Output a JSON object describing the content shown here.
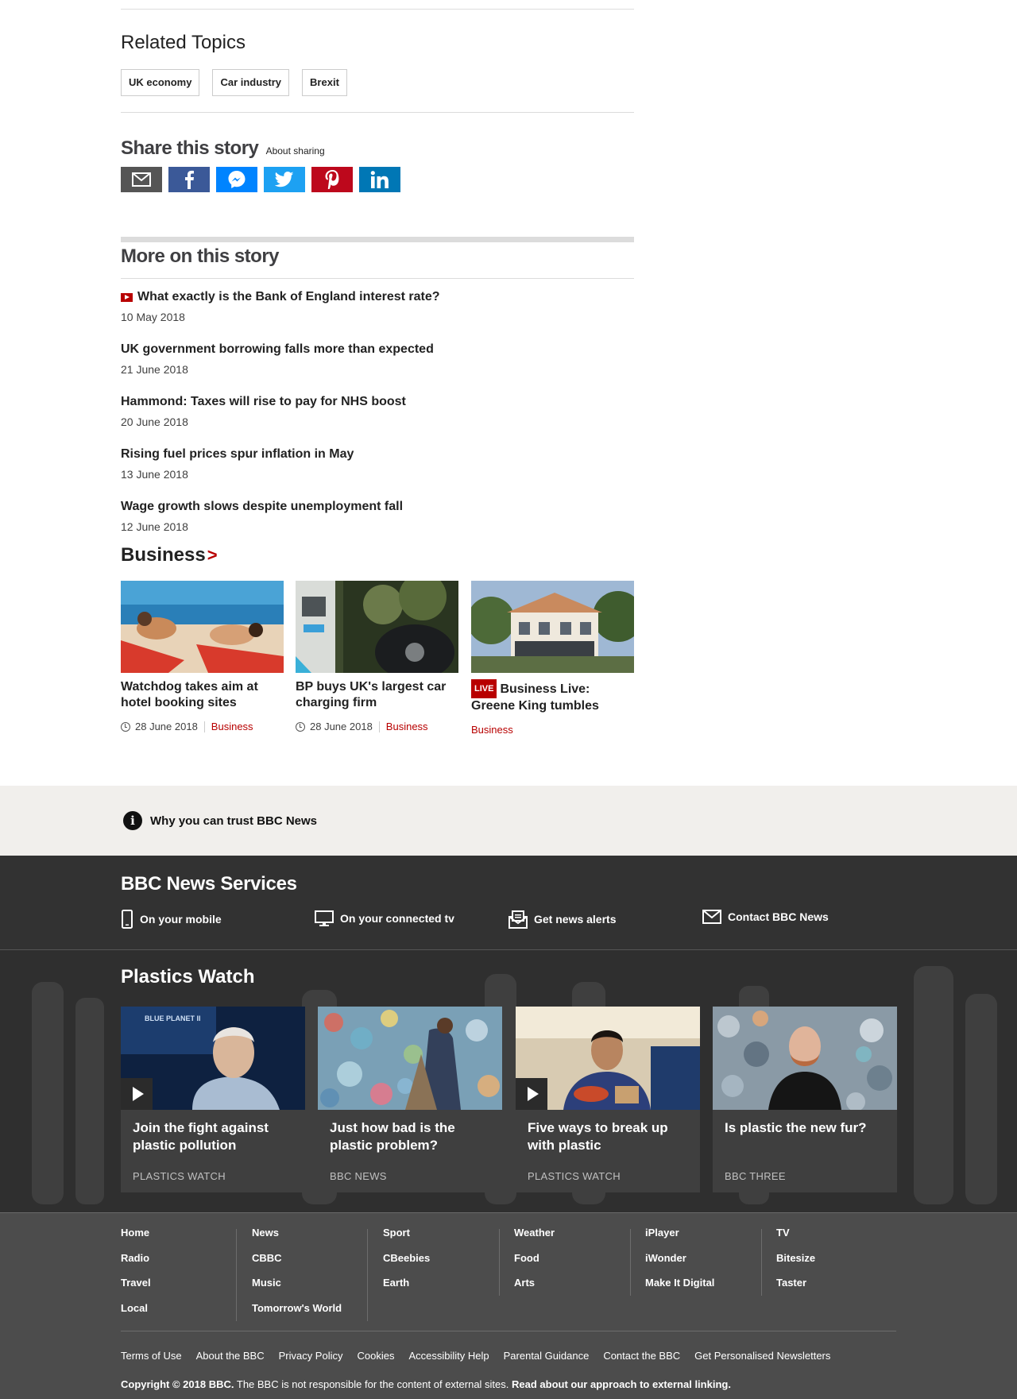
{
  "related": {
    "title": "Related Topics",
    "tags": [
      "UK economy",
      "Car industry",
      "Brexit"
    ]
  },
  "share": {
    "title": "Share this story",
    "about": "About sharing",
    "buttons": [
      {
        "name": "email",
        "color": "#555555"
      },
      {
        "name": "facebook",
        "color": "#3b5998"
      },
      {
        "name": "messenger",
        "color": "#0084ff"
      },
      {
        "name": "twitter",
        "color": "#1da1f2"
      },
      {
        "name": "pinterest",
        "color": "#bd081c"
      },
      {
        "name": "linkedin",
        "color": "#0077b5"
      }
    ]
  },
  "more": {
    "title": "More on this story",
    "stories": [
      {
        "headline": "What exactly is the Bank of England interest rate?",
        "date": "10 May 2018",
        "video": true
      },
      {
        "headline": "UK government borrowing falls more than expected",
        "date": "21 June 2018",
        "video": false
      },
      {
        "headline": "Hammond: Taxes will rise to pay for NHS boost",
        "date": "20 June 2018",
        "video": false
      },
      {
        "headline": "Rising fuel prices spur inflation in May",
        "date": "13 June 2018",
        "video": false
      },
      {
        "headline": "Wage growth slows despite unemployment fall",
        "date": "12 June 2018",
        "video": false
      }
    ]
  },
  "business": {
    "title": "Business",
    "chevron": ">",
    "cards": [
      {
        "title": "Watchdog takes aim at hotel booking sites",
        "date": "28 June 2018",
        "section": "Business"
      },
      {
        "title": "BP buys UK's largest car charging firm",
        "date": "28 June 2018",
        "section": "Business"
      },
      {
        "live": "LIVE",
        "title": "Business Live: Greene King tumbles",
        "section": "Business"
      }
    ]
  },
  "trust": {
    "text": "Why you can trust BBC News"
  },
  "services": {
    "title": "BBC News Services",
    "items": [
      {
        "label": "On your mobile",
        "icon": "mobile-icon"
      },
      {
        "label": "On your connected tv",
        "icon": "tv-icon"
      },
      {
        "label": "Get news alerts",
        "icon": "alerts-icon"
      },
      {
        "label": "Contact BBC News",
        "icon": "envelope-icon"
      }
    ]
  },
  "plastics": {
    "title": "Plastics Watch",
    "cards": [
      {
        "title": "Join the fight against plastic pollution",
        "source": "PLASTICS WATCH",
        "video": true
      },
      {
        "title": "Just how bad is the plastic problem?",
        "source": "BBC NEWS",
        "video": false
      },
      {
        "title": "Five ways to break up with plastic",
        "source": "PLASTICS WATCH",
        "video": true
      },
      {
        "title": "Is plastic the new fur?",
        "source": "BBC THREE",
        "video": false
      }
    ]
  },
  "footer": {
    "columns": [
      [
        "Home",
        "Radio",
        "Travel",
        "Local"
      ],
      [
        "News",
        "CBBC",
        "Music",
        "Tomorrow's World"
      ],
      [
        "Sport",
        "CBeebies",
        "Earth"
      ],
      [
        "Weather",
        "Food",
        "Arts"
      ],
      [
        "iPlayer",
        "iWonder",
        "Make It Digital"
      ],
      [
        "TV",
        "Bitesize",
        "Taster"
      ]
    ],
    "links": [
      "Terms of Use",
      "About the BBC",
      "Privacy Policy",
      "Cookies",
      "Accessibility Help",
      "Parental Guidance",
      "Contact the BBC",
      "Get Personalised Newsletters"
    ],
    "copyright_bold": "Copyright © 2018 BBC.",
    "copyright_text": " The BBC is not responsible for the content of external sites. ",
    "copyright_link": "Read about our approach to external linking."
  }
}
